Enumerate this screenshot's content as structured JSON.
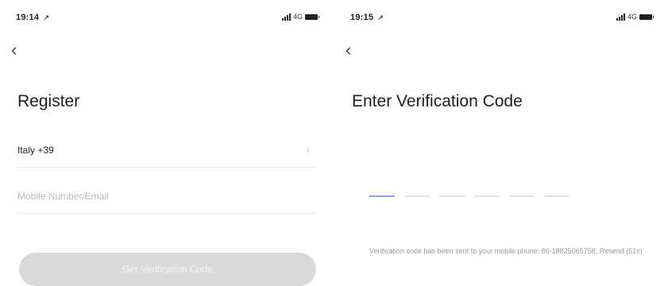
{
  "left": {
    "status": {
      "time": "19:14",
      "location_glyph": "↗",
      "network": "4G"
    },
    "back_glyph": "‹",
    "title": "Register",
    "country": {
      "label": "Italy +39",
      "chevron": "›"
    },
    "phone_input": {
      "placeholder": "Mobile Number/Email",
      "value": ""
    },
    "button_label": "Get Verification Code"
  },
  "right": {
    "status": {
      "time": "19:15",
      "location_glyph": "↗",
      "network": "4G"
    },
    "back_glyph": "‹",
    "title": "Enter Verification Code",
    "code_digits": [
      "",
      "",
      "",
      "",
      "",
      ""
    ],
    "info_text": "Verification code has been sent to your mobile phone: 86-18825065758, Resend (51s)"
  },
  "colors": {
    "accent": "#7fa6e6",
    "button_disabled": "#d9d9d9",
    "divider": "#e8e8e8"
  }
}
